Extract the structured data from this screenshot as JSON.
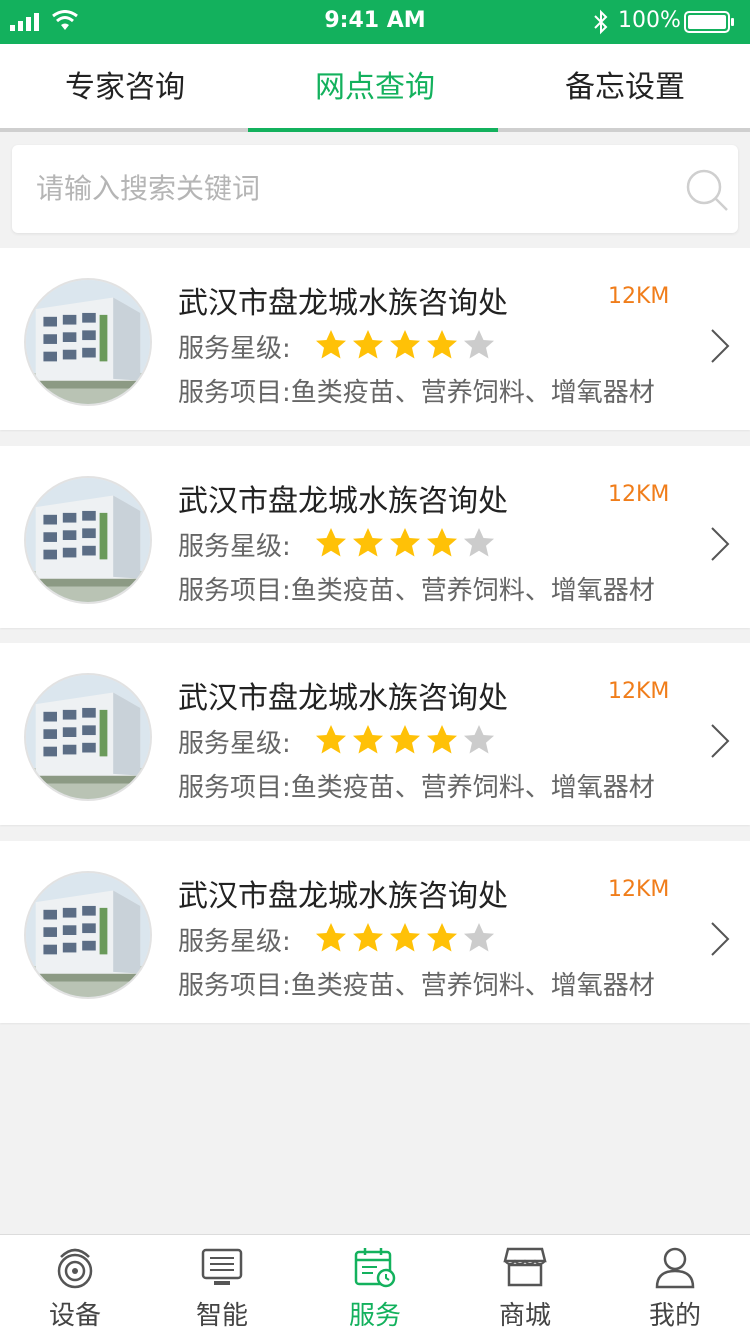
{
  "status_bar": {
    "time": "9:41 AM",
    "battery": "100%"
  },
  "tabs": [
    {
      "label": "专家咨询",
      "active": false
    },
    {
      "label": "网点查询",
      "active": true
    },
    {
      "label": "备忘设置",
      "active": false
    }
  ],
  "search": {
    "placeholder": "请输入搜索关键词",
    "icon": "search-icon"
  },
  "list": [
    {
      "name": "武汉市盘龙城水族咨询处",
      "distance": "12KM",
      "rating_label": "服务星级:",
      "rating": 4,
      "rating_max": 5,
      "services": "服务项目:鱼类疫苗、营养饲料、增氧器材"
    },
    {
      "name": "武汉市盘龙城水族咨询处",
      "distance": "12KM",
      "rating_label": "服务星级:",
      "rating": 4,
      "rating_max": 5,
      "services": "服务项目:鱼类疫苗、营养饲料、增氧器材"
    },
    {
      "name": "武汉市盘龙城水族咨询处",
      "distance": "12KM",
      "rating_label": "服务星级:",
      "rating": 4,
      "rating_max": 5,
      "services": "服务项目:鱼类疫苗、营养饲料、增氧器材"
    },
    {
      "name": "武汉市盘龙城水族咨询处",
      "distance": "12KM",
      "rating_label": "服务星级:",
      "rating": 4,
      "rating_max": 5,
      "services": "服务项目:鱼类疫苗、营养饲料、增氧器材"
    }
  ],
  "bottom_nav": [
    {
      "label": "设备",
      "icon": "device-icon",
      "active": false
    },
    {
      "label": "智能",
      "icon": "smart-icon",
      "active": false
    },
    {
      "label": "服务",
      "icon": "service-calendar-icon",
      "active": true
    },
    {
      "label": "商城",
      "icon": "shop-icon",
      "active": false
    },
    {
      "label": "我的",
      "icon": "profile-icon",
      "active": false
    }
  ],
  "colors": {
    "accent": "#13b15d",
    "distance": "#f07d1a",
    "star_on": "#ffc107",
    "star_off": "#cccccc"
  }
}
